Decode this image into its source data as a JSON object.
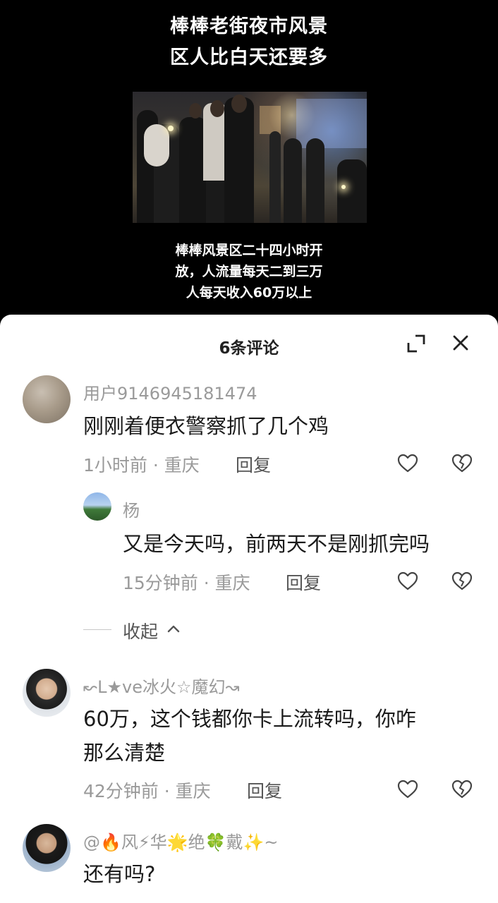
{
  "video": {
    "headline_line1": "棒棒老街夜市风景",
    "headline_line2": "区人比白天还要多",
    "caption_line1": "棒棒风景区二十四小时开",
    "caption_line2": "放，人流量每天二到三万",
    "caption_line3": "人每天收入60万以上"
  },
  "comments_sheet": {
    "title": "6条评论",
    "expand_icon": "expand-icon",
    "close_icon": "close-icon",
    "collapse_label": "收起",
    "comments": [
      {
        "username": "用户9146945181474",
        "text_lines": [
          "刚刚着便衣警察抓了几个鸡"
        ],
        "time": "1小时前",
        "location": "重庆",
        "reply_label": "回复",
        "replies": [
          {
            "username": "杨",
            "text_lines": [
              "又是今天吗，前两天不是刚抓完吗"
            ],
            "time": "15分钟前",
            "location": "重庆",
            "reply_label": "回复"
          }
        ]
      },
      {
        "username": "↜L★ve冰火☆魔幻↝",
        "text_lines": [
          "60万，这个钱都你卡上流转吗，你咋",
          "那么清楚"
        ],
        "time": "42分钟前",
        "location": "重庆",
        "reply_label": "回复"
      },
      {
        "username": "@🔥风⚡华🌟绝🍀戴✨~",
        "text_lines": [
          "还有吗?"
        ]
      }
    ]
  },
  "colors": {
    "sheet_bg": "#ffffff",
    "video_bg": "#000000",
    "muted_text": "#9a9a9a",
    "body_text": "#1b1b1b"
  }
}
